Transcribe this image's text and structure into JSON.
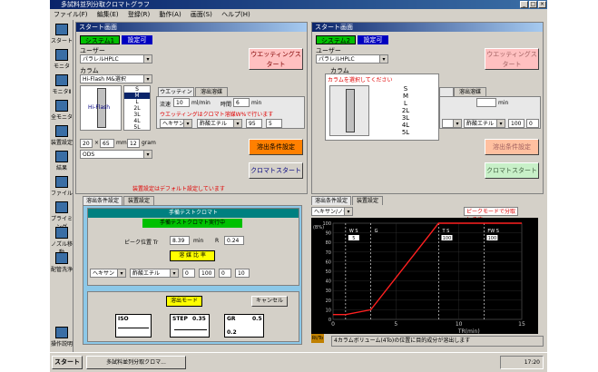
{
  "window": {
    "title": "多試料並列分取クロマトグラフ",
    "controls": [
      "_",
      "□",
      "×"
    ]
  },
  "menu": [
    "ファイル(F)",
    "編集(E)",
    "登録(R)",
    "動作(A)",
    "画面(S)",
    "ヘルプ(H)"
  ],
  "sidebar": [
    {
      "label": "スタート",
      "icon": "start-icon"
    },
    {
      "label": "モニタ",
      "icon": "monitor-icon"
    },
    {
      "label": "モニタⅡ",
      "icon": "monitor2-icon"
    },
    {
      "label": "全モニタ",
      "icon": "all-monitor-icon"
    },
    {
      "label": "装置設定",
      "icon": "device-settings-icon"
    },
    {
      "label": "結果",
      "icon": "results-icon"
    },
    {
      "label": "ファイル",
      "icon": "file-icon"
    },
    {
      "label": "プライミング",
      "icon": "priming-icon"
    },
    {
      "label": "ノズル移動",
      "icon": "nozzle-move-icon"
    },
    {
      "label": "配管洗浄",
      "icon": "pipe-wash-icon"
    },
    {
      "label": "操作説明",
      "icon": "help-icon"
    }
  ],
  "left": {
    "header": "スタート画面",
    "system_label": "システム1",
    "status": "設定可",
    "user_label": "ユーザー",
    "user_value": "パラレルHPLC",
    "column_label": "カラム",
    "column_value": "Hi-Flash M&選択",
    "column_image_text": "Hi-Flash",
    "sizes": [
      "S",
      "M",
      "L",
      "2L",
      "3L",
      "4L",
      "5L"
    ],
    "selected_size": "M",
    "tabs": [
      "ウエッティング",
      "溶出溶媒"
    ],
    "flow_label": "流速",
    "flow_value": "10",
    "flow_unit": "ml/min",
    "time_label": "時間",
    "time_value": "6",
    "time_unit": "min",
    "wetting_note": "ウエッティングはクロマト溶媒W%で行います",
    "solvent_a": "ヘキサン",
    "solvent_b": "酢酸エチル",
    "ratio_a": "95",
    "ratio_b": "5",
    "dim_w": "20",
    "dim_x": "×",
    "dim_l": "65",
    "dim_unit": "mm",
    "gram_value": "12",
    "gram_unit": "gram",
    "phase_value": "ODS",
    "wetting_start": "ウエッティングスタート",
    "elution_btn": "溶出条件設定",
    "chroma_start": "クロマトスタート",
    "default_note": "装置設定はデフォルト設定しています"
  },
  "right": {
    "header": "スタート画面",
    "system_label": "システム2",
    "status": "設定可",
    "user_label": "ユーザー",
    "user_value": "パラレルHPLC",
    "column_label": "カラム",
    "column_prompt": "カラムを選択してください",
    "sizes": [
      "S",
      "M",
      "L",
      "2L",
      "3L",
      "4L",
      "5L"
    ],
    "tabs": [
      "ウエッティング",
      "溶出溶媒"
    ],
    "time_unit": "min",
    "solvent_a": "ヘキサン",
    "solvent_b": "酢酸エチル",
    "ratio_a": "100",
    "ratio_b": "0",
    "wetting_start": "ウエッティングスタート",
    "elution_btn": "溶出条件設定",
    "chroma_start": "クロマトスタート"
  },
  "bottom": {
    "tab1": "溶出条件設定",
    "tab2": "装置設定",
    "prep_header": "手備テストクロマト",
    "prep_status": "手備テストクロマト実行中",
    "peak_label": "ピーク位置 Tr",
    "peak_value": "8.39",
    "peak_unit": "min",
    "r_label": "R",
    "r_value": "0.24",
    "ratio_header": "溶 媒 比 率",
    "sa": "ヘキサン",
    "sb": "酢酸エチル",
    "ra": "0",
    "rb": "100",
    "rc": "0",
    "rd": "10",
    "elute_mode": "溶出モード",
    "cancel": "キャンセル",
    "mode_iso": "ISO",
    "mode_step": "STEP",
    "step_val": "0.35",
    "mode_gr": "GR",
    "gr_val1": "0.5",
    "gr_val2": "0.2",
    "tab3": "溶出条件設定",
    "tab4": "装置設定",
    "solvent_sel": "ヘキサン/ノール",
    "mode_note": "ピークモードで分取します",
    "chart_status": "4カラムボリューム(4To)の位置に目的成分が溶出します",
    "rt_label": "Rt/To"
  },
  "chart_data": {
    "type": "line",
    "xlabel": "TR(min)",
    "ylabel": "(B%)",
    "xticks": [
      "0",
      "5",
      "10",
      "15"
    ],
    "yticks": [
      "100",
      "90",
      "80",
      "70",
      "60",
      "50",
      "40",
      "30",
      "20",
      "10",
      "0"
    ],
    "xlim": [
      0,
      15
    ],
    "ylim": [
      0,
      100
    ],
    "series": [
      {
        "x": [
          0,
          1,
          3,
          8.39,
          15
        ],
        "y": [
          5,
          5,
          10,
          100,
          100
        ]
      }
    ],
    "markers": [
      {
        "label": "W S",
        "value": "5",
        "x": 1
      },
      {
        "label": "G",
        "value": "",
        "x": 3
      },
      {
        "label": "T S",
        "value": "100",
        "x": 8.4
      },
      {
        "label": "FW S",
        "value": "100",
        "x": 12
      }
    ]
  },
  "taskbar": {
    "start": "スタート",
    "task": "多試料並列分取クロマ...",
    "clock": "17:20"
  }
}
